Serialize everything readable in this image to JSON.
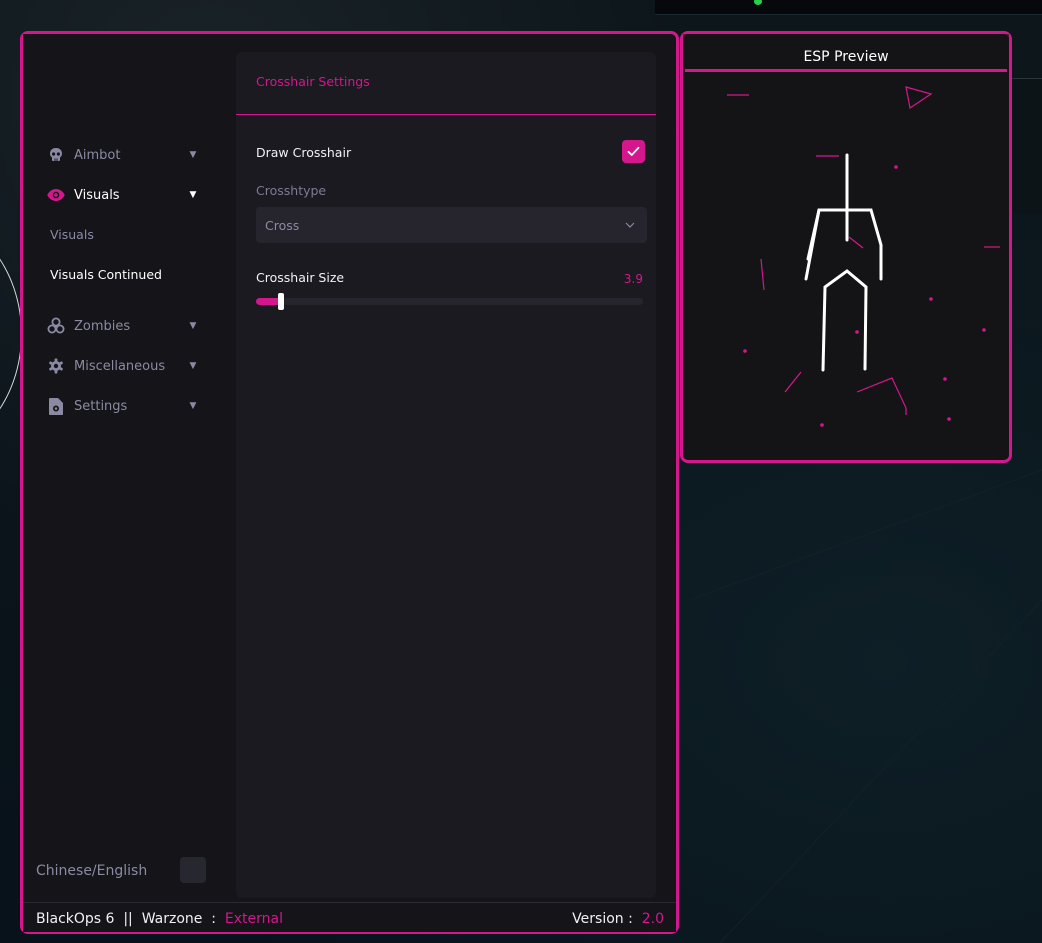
{
  "colors": {
    "accent": "#d4178c",
    "window_bg": "#141419",
    "panel_bg": "#1a1a20",
    "text_muted": "#8b8aa3"
  },
  "sidebar": {
    "items": [
      {
        "label": "Aimbot",
        "icon": "skull-icon",
        "arrow": "▼",
        "active": false
      },
      {
        "label": "Visuals",
        "icon": "eye-icon",
        "arrow": "▼",
        "active": true
      },
      {
        "label": "Zombies",
        "icon": "biohazard-icon",
        "arrow": "▼",
        "active": false
      },
      {
        "label": "Miscellaneous",
        "icon": "gear-icon",
        "arrow": "▼",
        "active": false
      },
      {
        "label": "Settings",
        "icon": "file-settings-icon",
        "arrow": "▼",
        "active": false
      }
    ],
    "visuals_subitems": [
      {
        "label": "Visuals",
        "active": false
      },
      {
        "label": "Visuals Continued",
        "active": true
      }
    ],
    "language_label": "Chinese/English"
  },
  "content": {
    "section_title": "Crosshair Settings",
    "draw_crosshair": {
      "label": "Draw Crosshair",
      "checked": true
    },
    "crosstype": {
      "label": "Crosshtype",
      "value": "Cross"
    },
    "crosshair_size": {
      "label": "Crosshair Size",
      "value": "3.9",
      "fill_fraction": 0.065
    }
  },
  "footer": {
    "game": "BlackOps 6",
    "separator": "||",
    "mode": "Warzone",
    "colon": ":",
    "type": "External",
    "version_label": "Version :",
    "version_value": "2.0"
  },
  "esp": {
    "title": "ESP Preview"
  }
}
